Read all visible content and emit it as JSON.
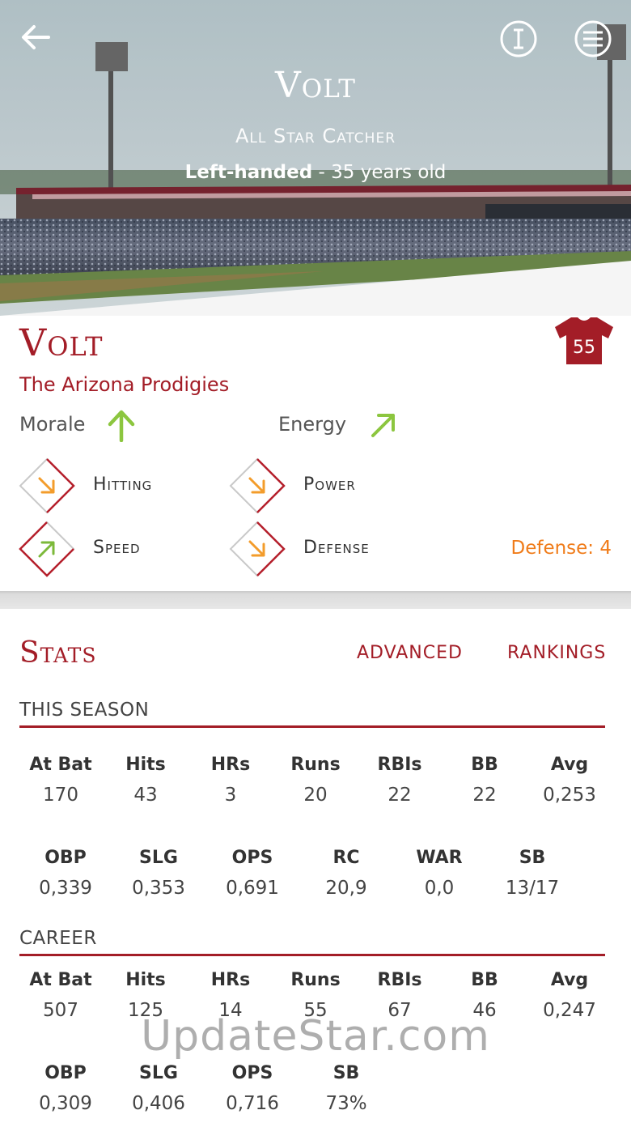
{
  "hero": {
    "name": "Volt",
    "role": "All Star Catcher",
    "handedness": "Left-handed",
    "age_text": " - 35 years old"
  },
  "player": {
    "name": "Volt",
    "team": "The Arizona Prodigies",
    "jersey_number": "55",
    "morale_label": "Morale",
    "energy_label": "Energy"
  },
  "skills": {
    "hitting": "Hitting",
    "power": "Power",
    "speed": "Speed",
    "defense": "Defense",
    "defense_value": "Defense: 4"
  },
  "stats": {
    "title": "Stats",
    "advanced": "ADVANCED",
    "rankings": "RANKINGS",
    "season_head": "THIS SEASON",
    "career_head": "CAREER",
    "season_row1": [
      {
        "label": "At Bat",
        "value": "170"
      },
      {
        "label": "Hits",
        "value": "43"
      },
      {
        "label": "HRs",
        "value": "3"
      },
      {
        "label": "Runs",
        "value": "20"
      },
      {
        "label": "RBIs",
        "value": "22"
      },
      {
        "label": "BB",
        "value": "22"
      },
      {
        "label": "Avg",
        "value": "0,253"
      }
    ],
    "season_row2": [
      {
        "label": "OBP",
        "value": "0,339"
      },
      {
        "label": "SLG",
        "value": "0,353"
      },
      {
        "label": "OPS",
        "value": "0,691"
      },
      {
        "label": "RC",
        "value": "20,9"
      },
      {
        "label": "WAR",
        "value": "0,0"
      },
      {
        "label": "SB",
        "value": "13/17"
      }
    ],
    "career_row1": [
      {
        "label": "At Bat",
        "value": "507"
      },
      {
        "label": "Hits",
        "value": "125"
      },
      {
        "label": "HRs",
        "value": "14"
      },
      {
        "label": "Runs",
        "value": "55"
      },
      {
        "label": "RBIs",
        "value": "67"
      },
      {
        "label": "BB",
        "value": "46"
      },
      {
        "label": "Avg",
        "value": "0,247"
      }
    ],
    "career_row2": [
      {
        "label": "OBP",
        "value": "0,309"
      },
      {
        "label": "SLG",
        "value": "0,406"
      },
      {
        "label": "OPS",
        "value": "0,716"
      },
      {
        "label": "SB",
        "value": "73%"
      }
    ]
  },
  "watermark": "UpdateStar.com",
  "colors": {
    "brand": "#a31d27",
    "mood_arrow": "#8cc63f",
    "down_arrow": "#f39c2b",
    "up_arrow": "#7cb93a",
    "defense_value": "#f07c1a"
  },
  "icons": {
    "back": "arrow-left-icon",
    "info": "info-icon",
    "menu": "hamburger-menu-icon",
    "jersey": "jersey-icon",
    "morale": "arrow-up-icon",
    "energy": "arrow-up-right-icon",
    "hitting": "arrow-down-right-icon",
    "power": "arrow-down-right-icon",
    "speed": "arrow-up-right-icon",
    "defense": "arrow-down-right-icon"
  }
}
